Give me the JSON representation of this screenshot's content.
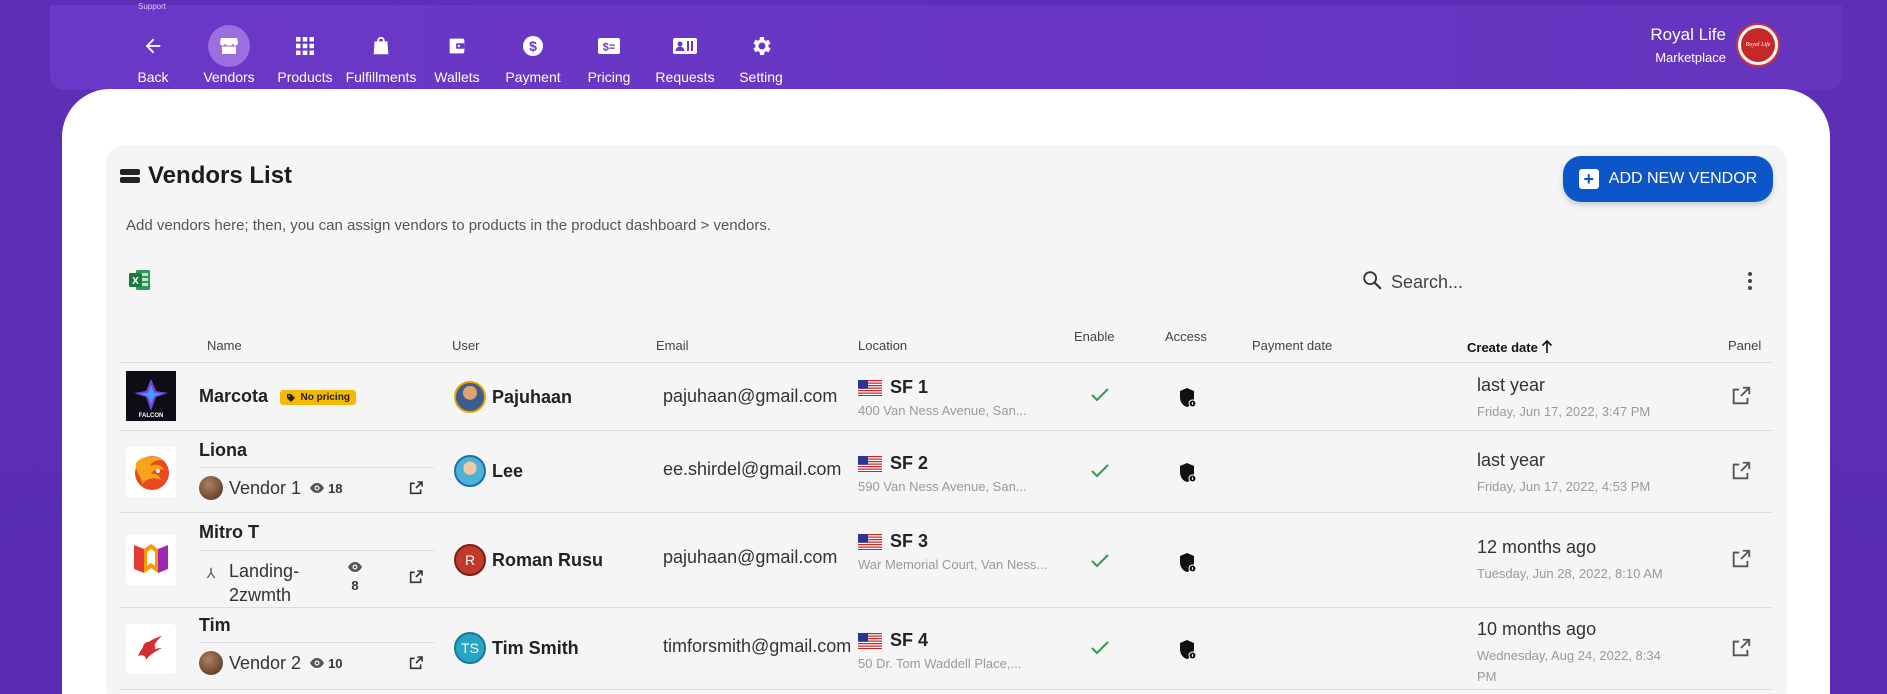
{
  "topbar": {
    "support_label": "Support",
    "nav": [
      {
        "label": "Back",
        "icon": "back-arrow-icon",
        "active": false
      },
      {
        "label": "Vendors",
        "icon": "store-icon",
        "active": true
      },
      {
        "label": "Products",
        "icon": "grid-icon",
        "active": false
      },
      {
        "label": "Fulfillments",
        "icon": "bag-icon",
        "active": false
      },
      {
        "label": "Wallets",
        "icon": "wallet-icon",
        "active": false
      },
      {
        "label": "Payment",
        "icon": "dollar-icon",
        "active": false
      },
      {
        "label": "Pricing",
        "icon": "price-tag-icon",
        "active": false
      },
      {
        "label": "Requests",
        "icon": "requests-icon",
        "active": false
      },
      {
        "label": "Setting",
        "icon": "gear-icon",
        "active": false
      }
    ],
    "brand": {
      "name": "Royal Life",
      "sub": "Marketplace",
      "logo_text": "Royal Life"
    }
  },
  "page": {
    "title": "Vendors List",
    "description": "Add vendors here; then, you can assign vendors to products in the product dashboard > vendors.",
    "add_button": "ADD NEW VENDOR",
    "search_placeholder": "Search..."
  },
  "table": {
    "headers": {
      "name": "Name",
      "user": "User",
      "email": "Email",
      "location": "Location",
      "enable": "Enable",
      "access": "Access",
      "payment_date": "Payment date",
      "create_date": "Create date",
      "panel": "Panel"
    },
    "rows": [
      {
        "name": "Marcota",
        "badge": "No pricing",
        "logo": "falcon",
        "user": "Pajuhaan",
        "user_avatar": "photo",
        "email": "pajuhaan@gmail.com",
        "location": "SF 1",
        "address": "400 Van Ness Avenue, San...",
        "created_rel": "last year",
        "created_abs": "Friday, Jun 17, 2022, 3:47 PM"
      },
      {
        "name": "Liona",
        "logo": "lion",
        "sub_name": "Vendor 1",
        "views": "18",
        "user": "Lee",
        "user_avatar": "photo",
        "email": "ee.shirdel@gmail.com",
        "location": "SF 2",
        "address": "590 Van Ness Avenue, San...",
        "created_rel": "last year",
        "created_abs": "Friday, Jun 17, 2022, 4:53 PM"
      },
      {
        "name": "Mitro T",
        "logo": "mitro",
        "sub_name": "Landing-2zwmth",
        "views": "8",
        "user": "Roman Rusu",
        "user_avatar": "R",
        "email": "pajuhaan@gmail.com",
        "location": "SF 3",
        "address": "War Memorial Court, Van Ness...",
        "created_rel": "12 months ago",
        "created_abs": "Tuesday, Jun 28, 2022, 8:10 AM"
      },
      {
        "name": "Tim",
        "logo": "tim",
        "sub_name": "Vendor 2",
        "views": "10",
        "user": "Tim Smith",
        "user_avatar": "TS",
        "email": "timforsmith@gmail.com",
        "location": "SF 4",
        "address": "50 Dr. Tom Waddell Place,...",
        "created_rel": "10 months ago",
        "created_abs": "Wednesday, Aug 24, 2022, 8:34 PM"
      }
    ]
  },
  "colors": {
    "background": "#5c2fb6",
    "topbar": "#6a38c6",
    "active_nav": "#9b6fe0",
    "primary_button": "#0d56c9",
    "badge": "#f5b900",
    "check": "#2e9d4a"
  }
}
